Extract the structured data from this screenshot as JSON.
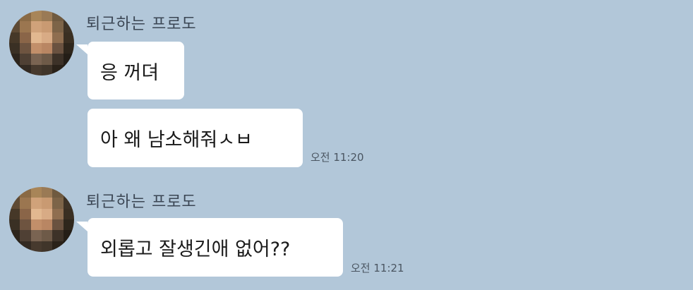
{
  "colors": {
    "background": "#b2c7d9",
    "bubble": "#ffffff",
    "sender_text": "#3b4654",
    "time_text": "#4a5561"
  },
  "groups": [
    {
      "sender": "퇴근하는 프로도",
      "avatar_icon": "pixelated-profile-avatar-icon",
      "messages": [
        {
          "text": "응 꺼뎌",
          "time": ""
        },
        {
          "text": "아 왜 남소해줘ㅅㅂ",
          "time": "오전 11:20"
        }
      ]
    },
    {
      "sender": "퇴근하는 프로도",
      "avatar_icon": "pixelated-profile-avatar-icon",
      "messages": [
        {
          "text": "외롭고 잘생긴애 없어??",
          "time": "오전 11:21"
        }
      ]
    }
  ]
}
